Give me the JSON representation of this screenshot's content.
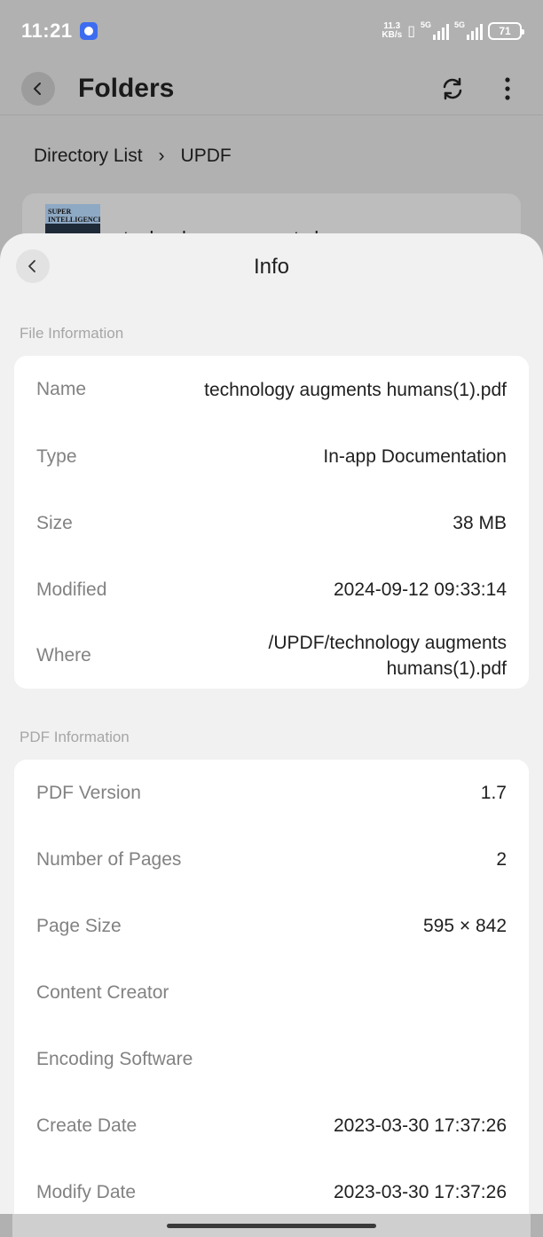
{
  "status": {
    "time": "11:21",
    "net_speed_value": "11.3",
    "net_speed_unit": "KB/s",
    "signal1_label": "5G",
    "signal2_label": "5G",
    "battery": "71"
  },
  "app": {
    "title": "Folders",
    "breadcrumb": {
      "root": "Directory List",
      "separator": "›",
      "current": "UPDF"
    },
    "file_card_name": "technology augments human",
    "thumb_text_line1": "SUPER",
    "thumb_text_line2": "INTELLIGENCE"
  },
  "sheet": {
    "title": "Info",
    "file_info": {
      "section_label": "File Information",
      "rows": [
        {
          "label": "Name",
          "value": "technology augments humans(1).pdf"
        },
        {
          "label": "Type",
          "value": "In-app Documentation"
        },
        {
          "label": "Size",
          "value": "38 MB"
        },
        {
          "label": "Modified",
          "value": "2024-09-12 09:33:14"
        },
        {
          "label": "Where",
          "value": "/UPDF/technology augments humans(1).pdf"
        }
      ]
    },
    "pdf_info": {
      "section_label": "PDF Information",
      "rows": [
        {
          "label": "PDF Version",
          "value": "1.7"
        },
        {
          "label": "Number of Pages",
          "value": "2"
        },
        {
          "label": "Page Size",
          "value": "595 × 842"
        },
        {
          "label": "Content Creator",
          "value": ""
        },
        {
          "label": "Encoding Software",
          "value": ""
        },
        {
          "label": "Create Date",
          "value": "2023-03-30 17:37:26"
        },
        {
          "label": "Modify Date",
          "value": "2023-03-30 17:37:26"
        }
      ]
    }
  },
  "colors": {
    "overlay_bg": "#b1b1b1",
    "sheet_bg": "#f1f1f1",
    "card_bg": "#ffffff",
    "label_gray": "#828282",
    "section_gray": "#a6a6a6"
  }
}
